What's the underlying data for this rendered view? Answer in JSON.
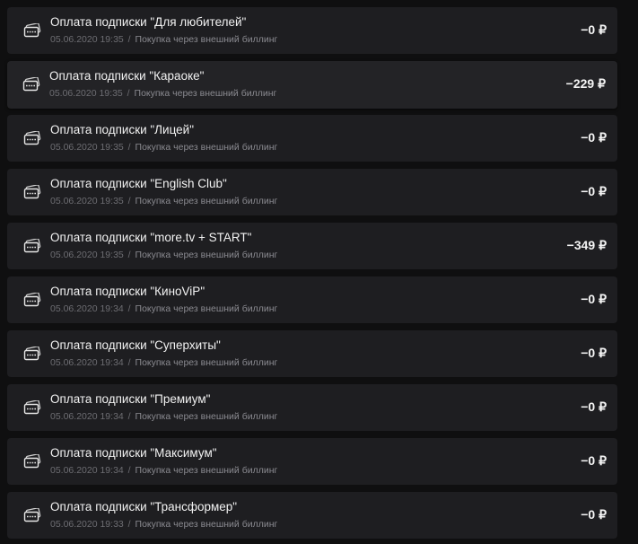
{
  "transactions": [
    {
      "title": "Оплата подписки \"Для любителей\"",
      "date": "05.06.2020 19:35",
      "separator": "/",
      "source": "Покупка через внешний биллинг",
      "amount": "−0 ₽"
    },
    {
      "title": "Оплата подписки \"Караоке\"",
      "date": "05.06.2020 19:35",
      "separator": "/",
      "source": "Покупка через внешний биллинг",
      "amount": "−229 ₽"
    },
    {
      "title": "Оплата подписки \"Лицей\"",
      "date": "05.06.2020 19:35",
      "separator": "/",
      "source": "Покупка через внешний биллинг",
      "amount": "−0 ₽"
    },
    {
      "title": "Оплата подписки \"English Club\"",
      "date": "05.06.2020 19:35",
      "separator": "/",
      "source": "Покупка через внешний биллинг",
      "amount": "−0 ₽"
    },
    {
      "title": "Оплата подписки \"more.tv + START\"",
      "date": "05.06.2020 19:35",
      "separator": "/",
      "source": "Покупка через внешний биллинг",
      "amount": "−349 ₽"
    },
    {
      "title": "Оплата подписки \"КиноViP\"",
      "date": "05.06.2020 19:34",
      "separator": "/",
      "source": "Покупка через внешний биллинг",
      "amount": "−0 ₽"
    },
    {
      "title": "Оплата подписки \"Суперхиты\"",
      "date": "05.06.2020 19:34",
      "separator": "/",
      "source": "Покупка через внешний биллинг",
      "amount": "−0 ₽"
    },
    {
      "title": "Оплата подписки \"Премиум\"",
      "date": "05.06.2020 19:34",
      "separator": "/",
      "source": "Покупка через внешний биллинг",
      "amount": "−0 ₽"
    },
    {
      "title": "Оплата подписки \"Максимум\"",
      "date": "05.06.2020 19:34",
      "separator": "/",
      "source": "Покупка через внешний биллинг",
      "amount": "−0 ₽"
    },
    {
      "title": "Оплата подписки \"Трансформер\"",
      "date": "05.06.2020 19:33",
      "separator": "/",
      "source": "Покупка через внешний биллинг",
      "amount": "−0 ₽"
    }
  ],
  "icon_name": "payment-card-icon",
  "colors": {
    "background": "#0f0f10",
    "row": "#1e1e21",
    "title": "#f2f2f2",
    "meta": "#6d6d72"
  }
}
